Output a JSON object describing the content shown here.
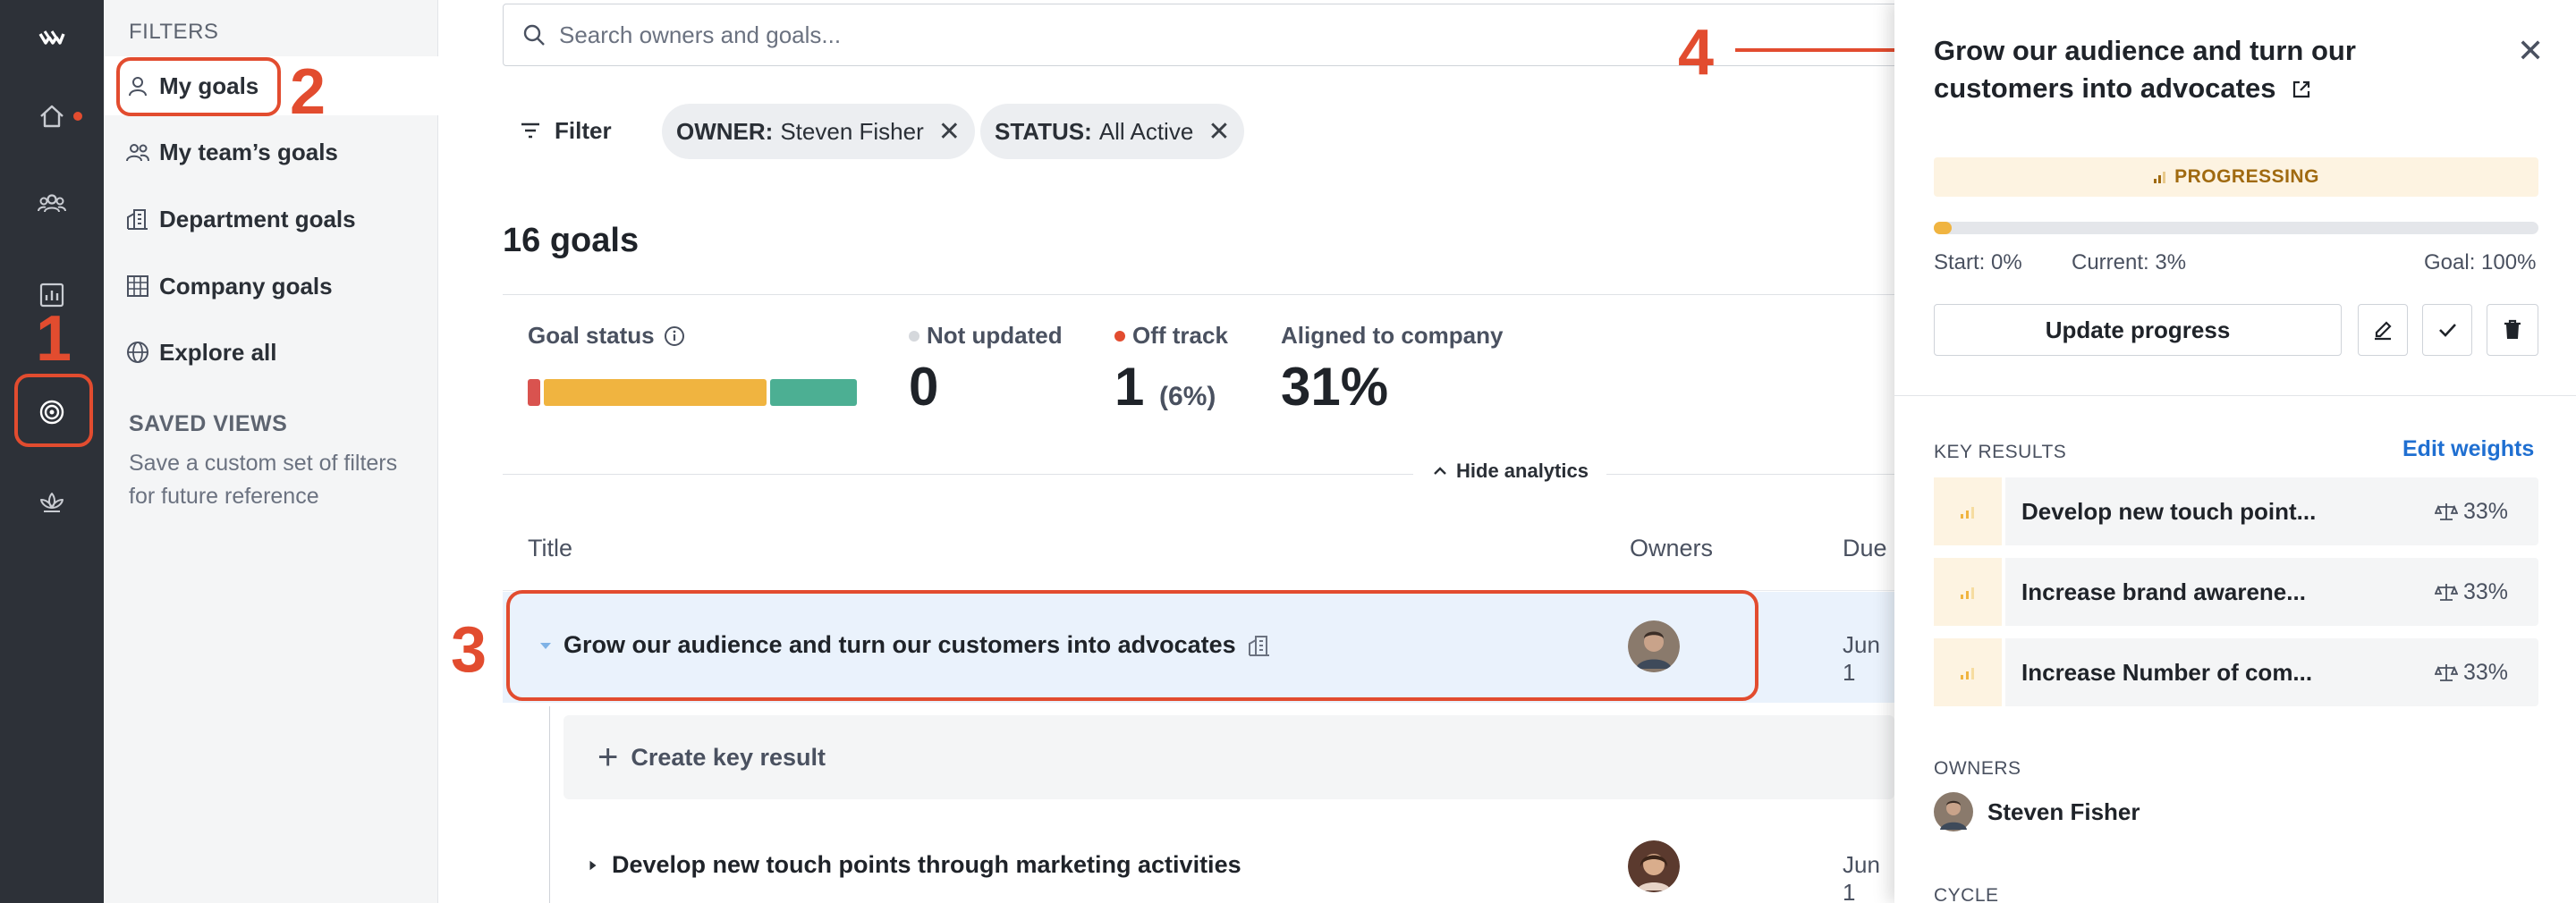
{
  "rail": {
    "items": [
      {
        "name": "logo-icon"
      },
      {
        "name": "home-icon",
        "badge": true
      },
      {
        "name": "people-icon"
      },
      {
        "name": "analytics-icon"
      },
      {
        "name": "goals-target-icon",
        "active": true
      },
      {
        "name": "wellbeing-icon"
      }
    ]
  },
  "sidebar": {
    "filters_heading": "FILTERS",
    "items": [
      {
        "label": "My goals",
        "icon": "person-icon",
        "active": true
      },
      {
        "label": "My team’s goals",
        "icon": "team-icon"
      },
      {
        "label": "Department goals",
        "icon": "department-icon"
      },
      {
        "label": "Company goals",
        "icon": "company-icon"
      },
      {
        "label": "Explore all",
        "icon": "globe-icon"
      }
    ],
    "saved_views_heading": "SAVED VIEWS",
    "saved_views_desc": "Save a custom set of filters for future reference"
  },
  "main": {
    "search_placeholder": "Search owners and goals...",
    "filter_label": "Filter",
    "chips": [
      {
        "key": "OWNER:",
        "value": "Steven Fisher"
      },
      {
        "key": "STATUS:",
        "value": "All Active"
      }
    ],
    "goals_count": "16 goals",
    "analytics": {
      "goal_status_label": "Goal status",
      "status_bar": [
        {
          "share": 0.04,
          "color": "#d9534f"
        },
        {
          "share": 0.69,
          "color": "#f0b440"
        },
        {
          "share": 0.27,
          "color": "#4caf93"
        }
      ],
      "not_updated_label": "Not updated",
      "not_updated_value": "0",
      "off_track_label": "Off track",
      "off_track_value": "1",
      "off_track_pct": "(6%)",
      "aligned_label": "Aligned to company",
      "aligned_value": "31%",
      "hide_label": "Hide analytics"
    },
    "table": {
      "col_title": "Title",
      "col_owners": "Owners",
      "col_due": "Due",
      "rows": [
        {
          "title": "Grow our audience and turn our customers into advocates",
          "due": "Jun 1"
        },
        {
          "title": "Develop new touch points through marketing activities",
          "due": "Jun 1"
        }
      ],
      "create_kr_label": "Create key result"
    }
  },
  "panel": {
    "title": "Grow our audience and turn our customers into advocates",
    "status": "PROGRESSING",
    "progress": 0.03,
    "start_label": "Start: 0%",
    "current_label": "Current: 3%",
    "goal_label": "Goal: 100%",
    "update_button": "Update progress",
    "key_results_heading": "KEY RESULTS",
    "edit_weights": "Edit weights",
    "key_results": [
      {
        "name": "Develop new touch point...",
        "weight": "33%"
      },
      {
        "name": "Increase brand awarene...",
        "weight": "33%"
      },
      {
        "name": "Increase Number of com...",
        "weight": "33%"
      }
    ],
    "owners_heading": "OWNERS",
    "owner_name": "Steven Fisher",
    "cycle_heading": "CYCLE"
  },
  "annotations": [
    "1",
    "2",
    "3",
    "4"
  ],
  "colors": {
    "accent": "#e24c2f",
    "link": "#1f6fd1",
    "rail": "#2d3138"
  }
}
